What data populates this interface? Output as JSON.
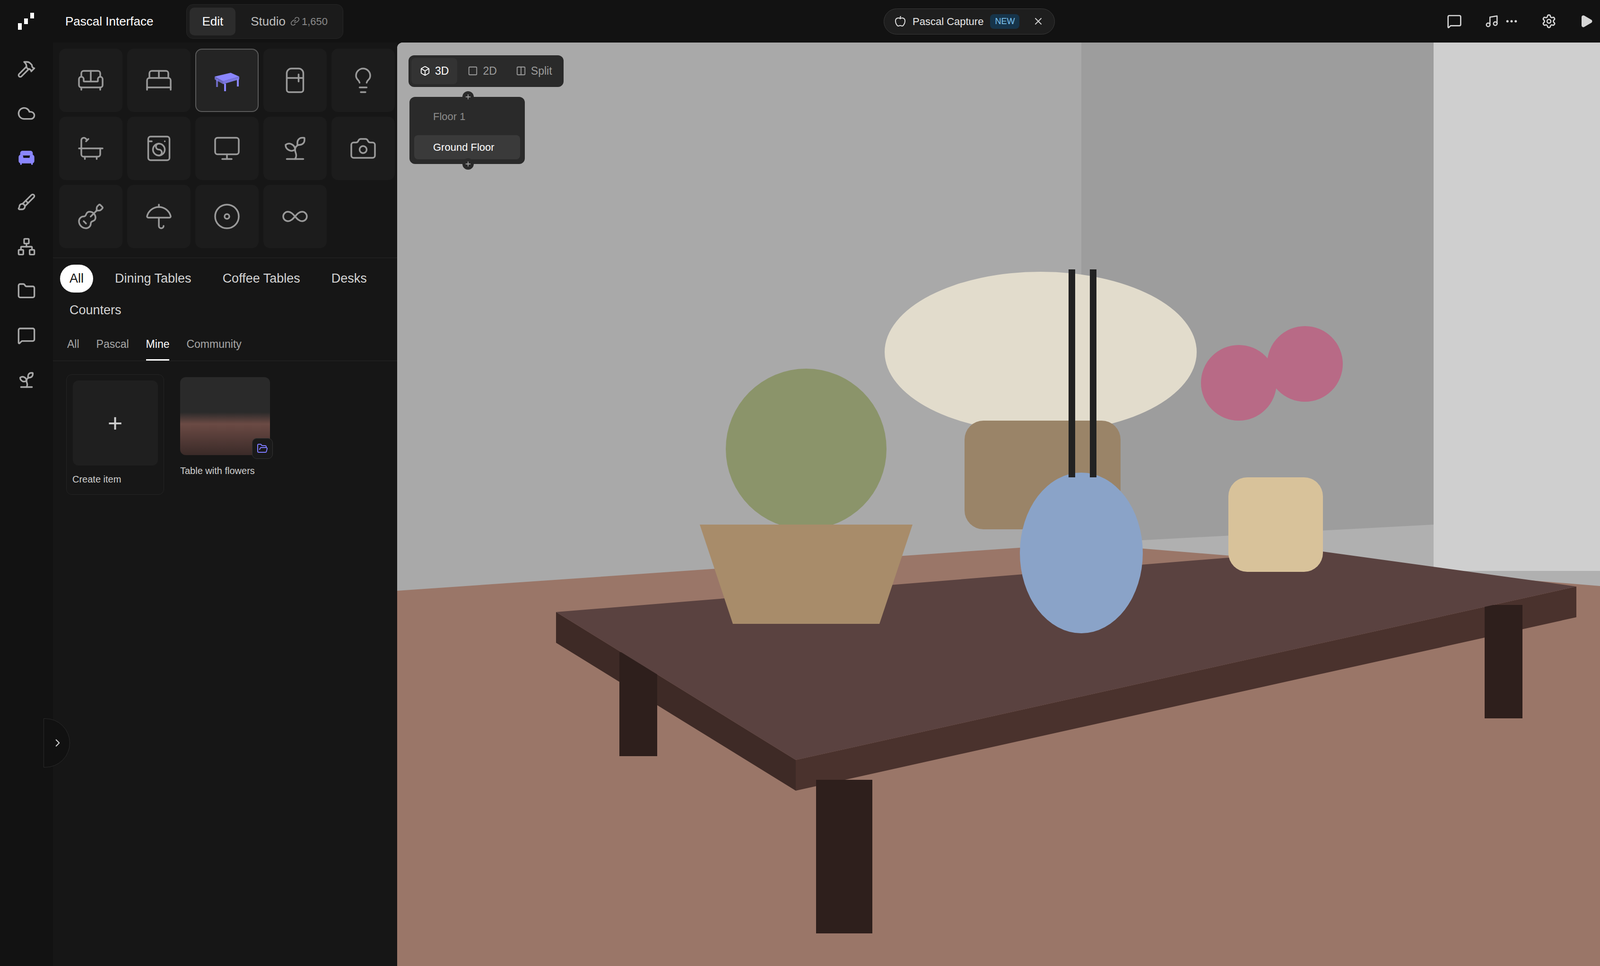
{
  "app": {
    "title": "Pascal Interface"
  },
  "mode_tabs": [
    {
      "label": "Edit",
      "selected": true,
      "count": ""
    },
    {
      "label": "Studio",
      "selected": false,
      "count": "1,650"
    }
  ],
  "capture": {
    "label": "Pascal Capture",
    "badge": "NEW"
  },
  "rail": [
    {
      "selected": false
    },
    {
      "selected": false
    },
    {
      "selected": true
    },
    {
      "selected": false
    },
    {
      "selected": false
    },
    {
      "selected": false
    },
    {
      "selected": false
    },
    {
      "selected": false
    }
  ],
  "catalog": [
    {
      "selected": false
    },
    {
      "selected": false
    },
    {
      "selected": true
    },
    {
      "selected": false
    },
    {
      "selected": false
    },
    {
      "selected": false
    },
    {
      "selected": false
    },
    {
      "selected": false
    },
    {
      "selected": false
    },
    {
      "selected": false
    },
    {
      "selected": false
    },
    {
      "selected": false
    },
    {
      "selected": false
    },
    {
      "selected": false
    }
  ],
  "categories": [
    {
      "label": "All",
      "selected": true
    },
    {
      "label": "Dining Tables",
      "selected": false
    },
    {
      "label": "Coffee Tables",
      "selected": false
    },
    {
      "label": "Desks",
      "selected": false
    },
    {
      "label": "Counters",
      "selected": false
    }
  ],
  "sources": [
    {
      "label": "All",
      "selected": false
    },
    {
      "label": "Pascal",
      "selected": false
    },
    {
      "label": "Mine",
      "selected": true
    },
    {
      "label": "Community",
      "selected": false
    }
  ],
  "items": [
    {
      "kind": "create",
      "label": "Create item",
      "symbol": "+"
    },
    {
      "kind": "item",
      "label": "Table with flowers",
      "symbol": ""
    }
  ],
  "view_modes": [
    {
      "label": "3D",
      "selected": true
    },
    {
      "label": "2D",
      "selected": false
    },
    {
      "label": "Split",
      "selected": false
    }
  ],
  "floors": [
    {
      "label": "Floor 1",
      "selected": false
    },
    {
      "label": "Ground Floor",
      "selected": true
    }
  ]
}
